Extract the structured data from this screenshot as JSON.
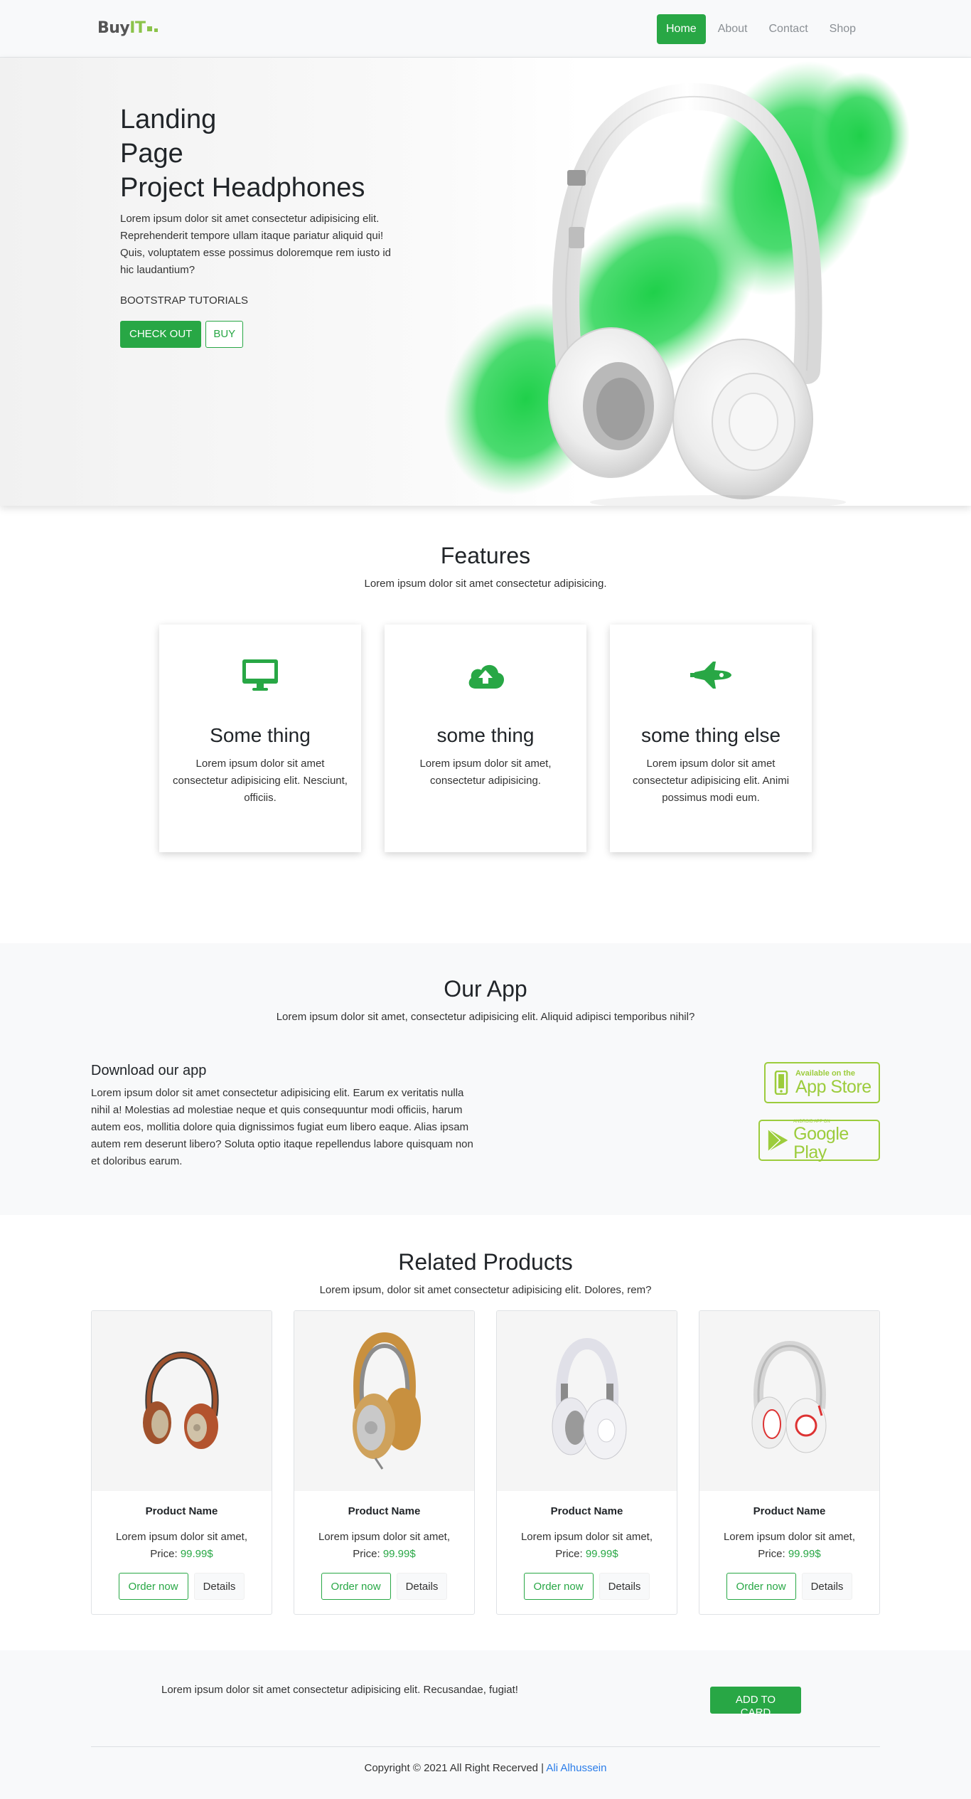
{
  "brand": {
    "name_prefix": "Buy",
    "name_suffix": "IT"
  },
  "nav": {
    "items": [
      {
        "label": "Home",
        "active": true
      },
      {
        "label": "About",
        "active": false
      },
      {
        "label": "Contact",
        "active": false
      },
      {
        "label": "Shop",
        "active": false
      }
    ]
  },
  "hero": {
    "title_line1": "Landing",
    "title_line2": "Page",
    "title_line3": "Project Headphones",
    "description": "Lorem ipsum dolor sit amet consectetur adipisicing elit. Reprehenderit tempore ullam itaque pariatur aliquid qui! Quis, voluptatem esse possimus doloremque rem iusto id hic laudantium?",
    "tag": "BOOTSTRAP TUTORIALS",
    "checkout_label": "CHECK OUT",
    "buy_label": "BUY"
  },
  "features": {
    "title": "Features",
    "subtitle": "Lorem ipsum dolor sit amet consectetur adipisicing.",
    "cards": [
      {
        "icon": "desktop-icon",
        "title": "Some thing",
        "text": "Lorem ipsum dolor sit amet consectetur adipisicing elit. Nesciunt, officiis."
      },
      {
        "icon": "cloud-upload-icon",
        "title": "some thing",
        "text": "Lorem ipsum dolor sit amet, consectetur adipisicing."
      },
      {
        "icon": "space-shuttle-icon",
        "title": "some thing else",
        "text": "Lorem ipsum dolor sit amet consectetur adipisicing elit. Animi possimus modi eum."
      }
    ]
  },
  "app": {
    "title": "Our App",
    "subtitle": "Lorem ipsum dolor sit amet, consectetur adipisicing elit. Aliquid adipisci temporibus nihil?",
    "heading": "Download our app",
    "text": "Lorem ipsum dolor sit amet consectetur adipisicing elit. Earum ex veritatis nulla nihil a! Molestias ad molestiae neque et quis consequuntur modi officiis, harum autem eos, mollitia dolore quia dignissimos fugiat eum libero eaque. Alias ipsam autem rem deserunt libero? Soluta optio itaque repellendus labore quisquam non et doloribus earum.",
    "appstore_small": "Available on the",
    "appstore_big": "App Store",
    "googleplay_small": "ANDROID APP ON",
    "googleplay_big": "Google Play"
  },
  "products": {
    "title": "Related Products",
    "subtitle": "Lorem ipsum, dolor sit amet consectetur adipisicing elit. Dolores, rem?",
    "items": [
      {
        "name": "Product Name",
        "desc": "Lorem ipsum dolor sit amet,",
        "price_label": "Price:",
        "price": "99.99$",
        "order_label": "Order now",
        "details_label": "Details"
      },
      {
        "name": "Product Name",
        "desc": "Lorem ipsum dolor sit amet,",
        "price_label": "Price:",
        "price": "99.99$",
        "order_label": "Order now",
        "details_label": "Details"
      },
      {
        "name": "Product Name",
        "desc": "Lorem ipsum dolor sit amet,",
        "price_label": "Price:",
        "price": "99.99$",
        "order_label": "Order now",
        "details_label": "Details"
      },
      {
        "name": "Product Name",
        "desc": "Lorem ipsum dolor sit amet,",
        "price_label": "Price:",
        "price": "99.99$",
        "order_label": "Order now",
        "details_label": "Details"
      }
    ]
  },
  "footer": {
    "text": "Lorem ipsum dolor sit amet consectetur adipisicing elit. Recusandae, fugiat!",
    "button_label": "ADD TO CARD",
    "copyright": "Copyright © 2021 All Right Recerved |",
    "author": "Ali Alhussein"
  },
  "colors": {
    "accent": "#28a745",
    "brand": "#8bc34a",
    "store_badge": "#9ccc3c",
    "link": "#2b7de9"
  }
}
